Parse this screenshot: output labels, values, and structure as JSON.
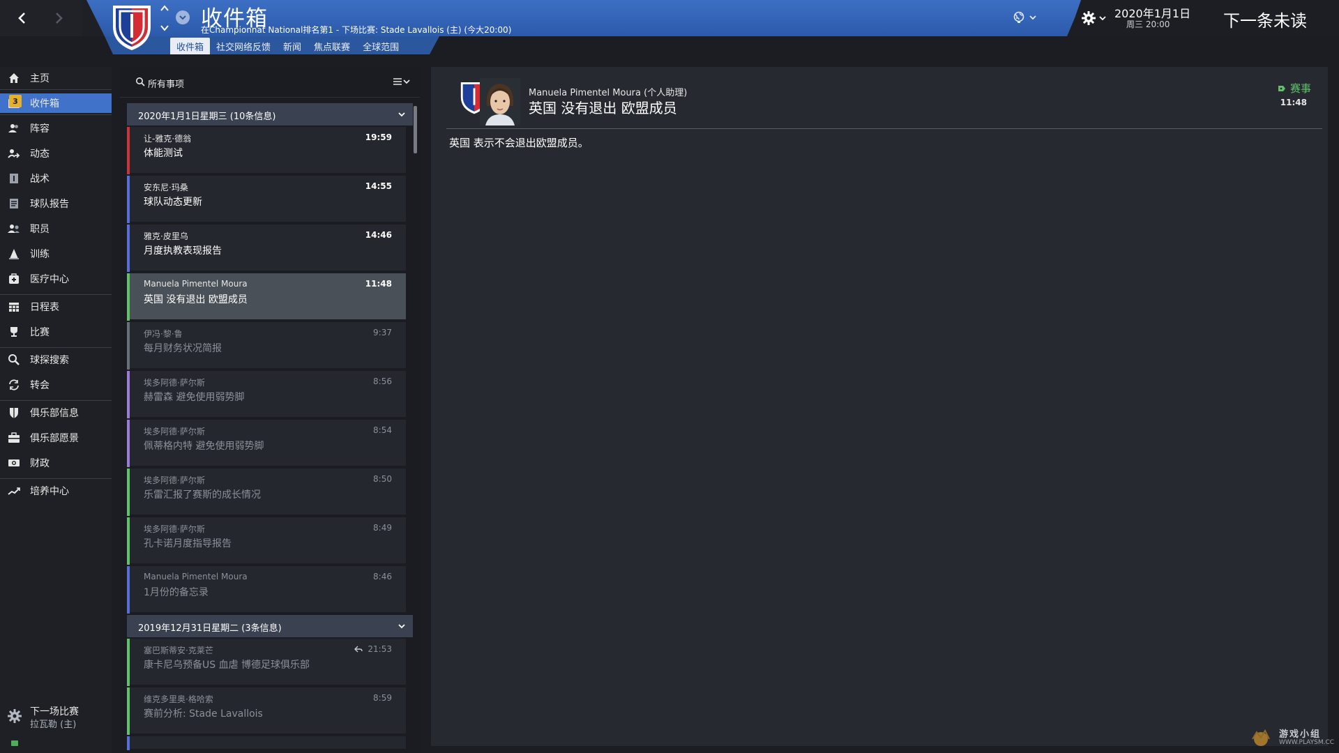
{
  "header": {
    "title": "收件箱",
    "subtitle": "在Championnat National排名第1 - 下场比赛: Stade Lavallois (主) (今大20:00)",
    "tabs": [
      {
        "label": "收件箱",
        "active": true
      },
      {
        "label": "社交网络反馈",
        "active": false
      },
      {
        "label": "新闻",
        "active": false
      },
      {
        "label": "焦点联赛",
        "active": false
      },
      {
        "label": "全球范围",
        "active": false
      }
    ],
    "date": "2020年1月1日",
    "time": "周三 20:00",
    "next_unread": "下一条未读",
    "colors": {
      "accent": "#3f72c8",
      "band": "#2c5aab"
    }
  },
  "sidebar": {
    "items": [
      {
        "label": "主页",
        "icon": "home-icon"
      },
      {
        "label": "收件箱",
        "icon": "inbox-icon",
        "badge": "3",
        "active": true
      },
      {
        "label": "阵容",
        "icon": "squad-icon"
      },
      {
        "label": "动态",
        "icon": "dynamics-icon"
      },
      {
        "label": "战术",
        "icon": "tactics-icon"
      },
      {
        "label": "球队报告",
        "icon": "report-icon"
      },
      {
        "label": "职员",
        "icon": "staff-icon"
      },
      {
        "label": "训练",
        "icon": "training-icon"
      },
      {
        "label": "医疗中心",
        "icon": "medical-icon"
      },
      {
        "label": "日程表",
        "icon": "calendar-icon"
      },
      {
        "label": "比赛",
        "icon": "trophy-icon"
      },
      {
        "label": "球探搜索",
        "icon": "scouting-icon"
      },
      {
        "label": "转会",
        "icon": "transfer-icon"
      },
      {
        "label": "俱乐部信息",
        "icon": "club-shield-icon"
      },
      {
        "label": "俱乐部愿景",
        "icon": "vision-icon"
      },
      {
        "label": "财政",
        "icon": "finance-icon"
      },
      {
        "label": "培养中心",
        "icon": "development-icon"
      }
    ],
    "next_match": {
      "title": "下一场比赛",
      "subtitle": "拉瓦勒 (主)"
    }
  },
  "list": {
    "search_label": "所有事项",
    "groups": [
      {
        "header": "2020年1月1日星期三 (10条信息)",
        "messages": [
          {
            "sender": "让-雅克·德翁",
            "subject": "体能测试",
            "time": "19:59",
            "color": "#c8343c",
            "read": false
          },
          {
            "sender": "安东尼·玛桑",
            "subject": "球队动态更新",
            "time": "14:55",
            "color": "#5a6fd6",
            "read": false
          },
          {
            "sender": "雅克·皮里乌",
            "subject": "月度执教表现报告",
            "time": "14:46",
            "color": "#5a6fd6",
            "read": false
          },
          {
            "sender": "Manuela Pimentel Moura",
            "subject": "英国 没有退出 欧盟成员",
            "time": "11:48",
            "color": "#62c06b",
            "read": false,
            "selected": true
          },
          {
            "sender": "伊冯·黎·鲁",
            "subject": "每月财务状况简报",
            "time": "9:37",
            "color": "#6b6f77",
            "read": true
          },
          {
            "sender": "埃多阿德·萨尔斯",
            "subject": "赫雷森 避免使用弱势脚",
            "time": "8:56",
            "color": "#9b7bd6",
            "read": true
          },
          {
            "sender": "埃多阿德·萨尔斯",
            "subject": "佩蒂格内特 避免使用弱势脚",
            "time": "8:54",
            "color": "#9b7bd6",
            "read": true
          },
          {
            "sender": "埃多阿德·萨尔斯",
            "subject": "乐雷汇报了赛斯的成长情况",
            "time": "8:50",
            "color": "#62c06b",
            "read": true
          },
          {
            "sender": "埃多阿德·萨尔斯",
            "subject": "孔卡诺月度指导报告",
            "time": "8:49",
            "color": "#62c06b",
            "read": true
          },
          {
            "sender": "Manuela Pimentel Moura",
            "subject": "1月份的备忘录",
            "time": "8:46",
            "color": "#5a6fd6",
            "read": true
          }
        ]
      },
      {
        "header": "2019年12月31日星期二 (3条信息)",
        "messages": [
          {
            "sender": "塞巴斯蒂安·克莱芒",
            "subject": "康卡尼乌预备US 血虐 博德足球俱乐部",
            "time": "21:53",
            "color": "#62c06b",
            "read": true,
            "replied": true
          },
          {
            "sender": "维克多里奥·格哈索",
            "subject": "赛前分析: Stade Lavallois",
            "time": "8:59",
            "color": "#62c06b",
            "read": true
          }
        ]
      }
    ]
  },
  "detail": {
    "sender": "Manuela Pimentel Moura (个人助理)",
    "subject": "英国 没有退出 欧盟成员",
    "tag": "赛事",
    "time": "11:48",
    "body": "英国 表示不会退出欧盟成员。"
  },
  "watermark": {
    "text": "游戏小组",
    "url": "WWW.PLAYSM.CC"
  }
}
